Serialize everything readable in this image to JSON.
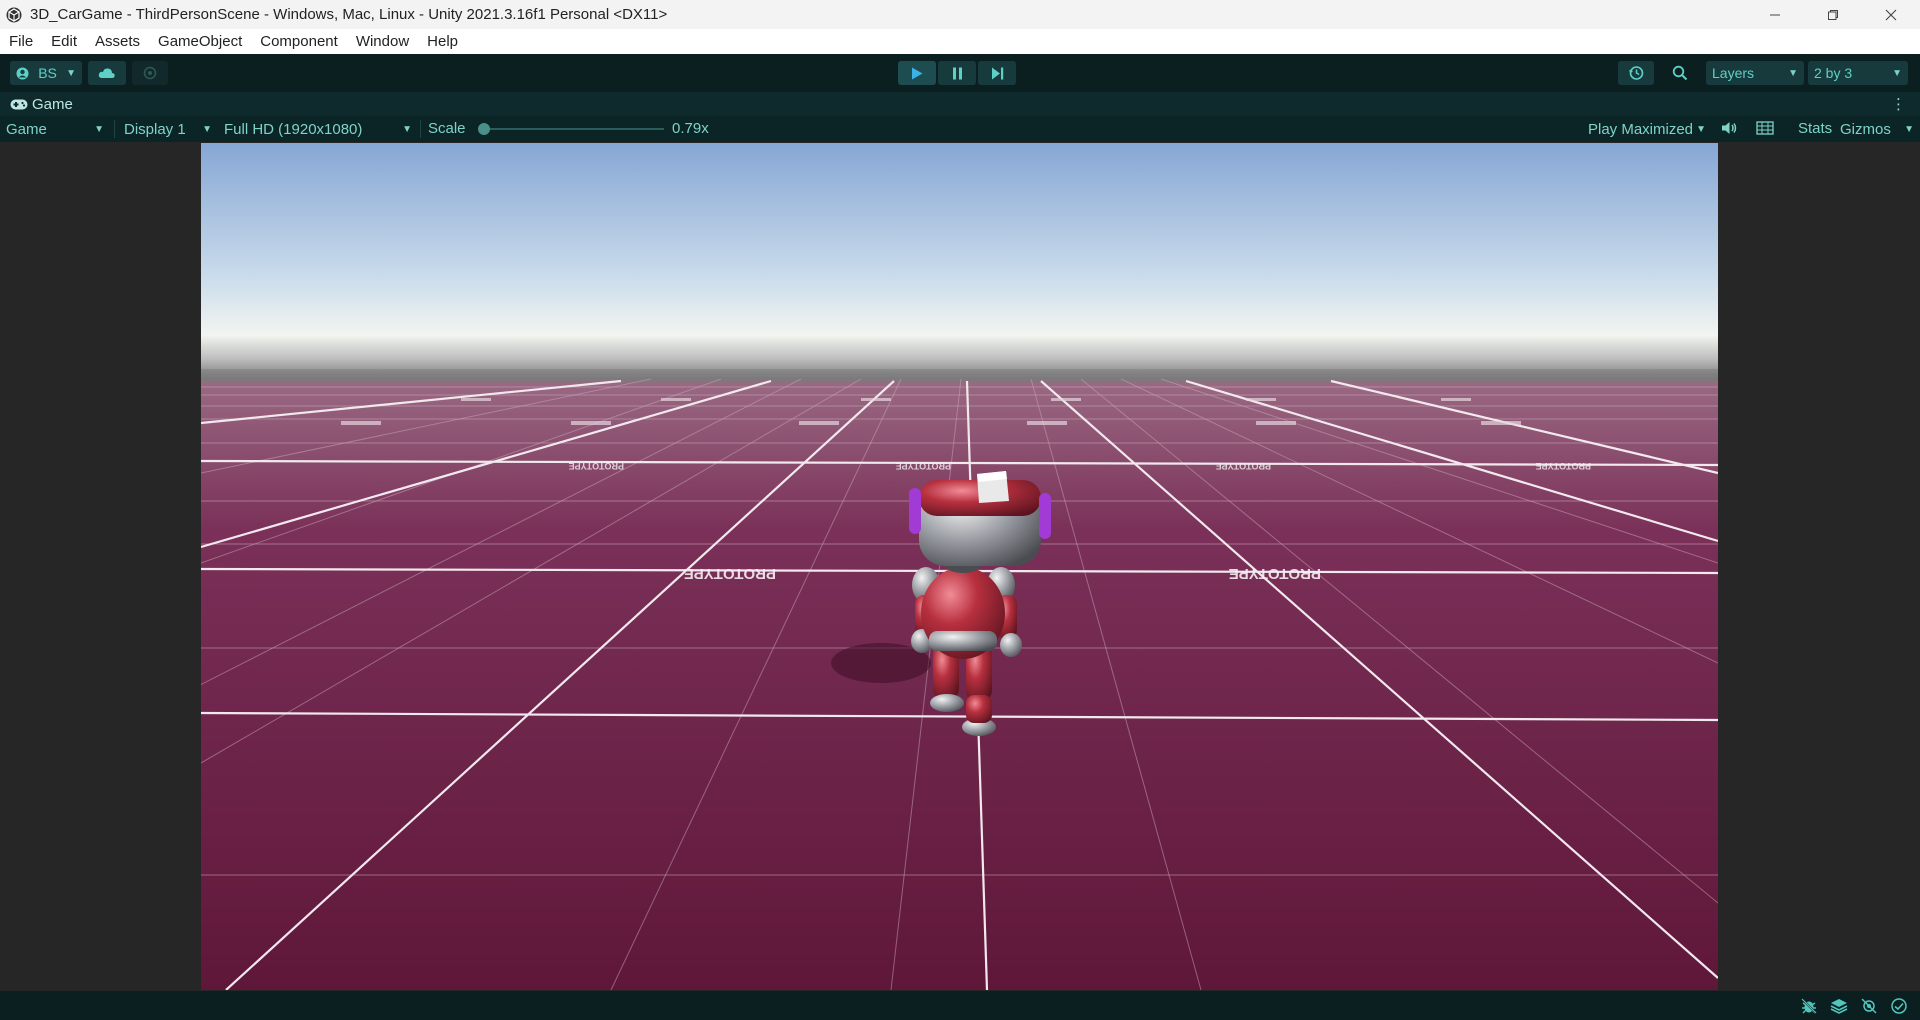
{
  "window": {
    "title": "3D_CarGame - ThirdPersonScene - Windows, Mac, Linux - Unity 2021.3.16f1 Personal <DX11>"
  },
  "menu": [
    "File",
    "Edit",
    "Assets",
    "GameObject",
    "Component",
    "Window",
    "Help"
  ],
  "toolbar": {
    "account_label": "BS",
    "icons": [
      "user-icon",
      "cloud-icon",
      "collab-icon",
      "play-icon",
      "pause-icon",
      "step-icon",
      "history-icon",
      "search-icon"
    ],
    "layers_label": "Layers",
    "layout_label": "2 by 3",
    "play_active": true
  },
  "tab": {
    "label": "Game",
    "icon": "gamepad-icon"
  },
  "game_toolbar": {
    "view_mode": "Game",
    "display": "Display 1",
    "resolution": "Full HD (1920x1080)",
    "scale_label": "Scale",
    "scale_value": "0.79x",
    "play_mode": "Play Maximized",
    "stats_label": "Stats",
    "gizmos_label": "Gizmos"
  },
  "scene": {
    "floor_text": "PROTOTYPE",
    "sky_top": "#8aaad6",
    "horizon": "#f2f5f0",
    "floor_color": "#6e1c45",
    "character": "robot"
  },
  "status_icons": [
    "bug-icon",
    "layers-status-icon",
    "network-icon",
    "check-circle-icon"
  ]
}
